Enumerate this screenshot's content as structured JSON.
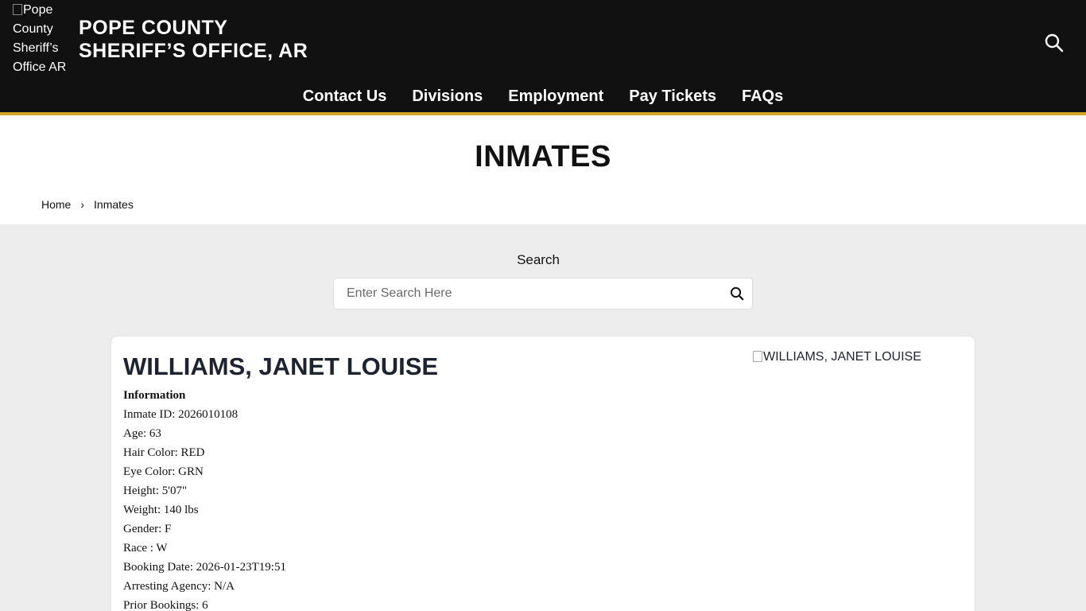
{
  "header": {
    "logo_alt": "Pope County Sheriff’s Office AR",
    "title_line1": "POPE COUNTY",
    "title_line2": "SHERIFF’S OFFICE, AR",
    "search_icon": "search-icon",
    "nav": [
      "Contact Us",
      "Divisions",
      "Employment",
      "Pay Tickets",
      "FAQs"
    ],
    "accent_color": "#d4a72c",
    "background_color": "#111111"
  },
  "page": {
    "title": "INMATES",
    "breadcrumb": {
      "home": "Home",
      "separator": "›",
      "current": "Inmates"
    }
  },
  "search": {
    "label": "Search",
    "placeholder": "Enter Search Here",
    "value": "",
    "button_icon": "search-icon"
  },
  "inmate": {
    "name": "WILLIAMS, JANET LOUISE",
    "photo_alt": "WILLIAMS, JANET LOUISE",
    "info_heading": "Information",
    "fields": [
      "Inmate ID: 2026010108",
      "Age: 63",
      "Hair Color: RED",
      "Eye Color: GRN",
      "Height: 5'07\"",
      "Weight: 140 lbs",
      "Gender: F",
      "Race : W",
      "Booking Date: 2026-01-23T19:51",
      "Arresting Agency: N/A",
      "Prior Bookings: 6"
    ]
  }
}
